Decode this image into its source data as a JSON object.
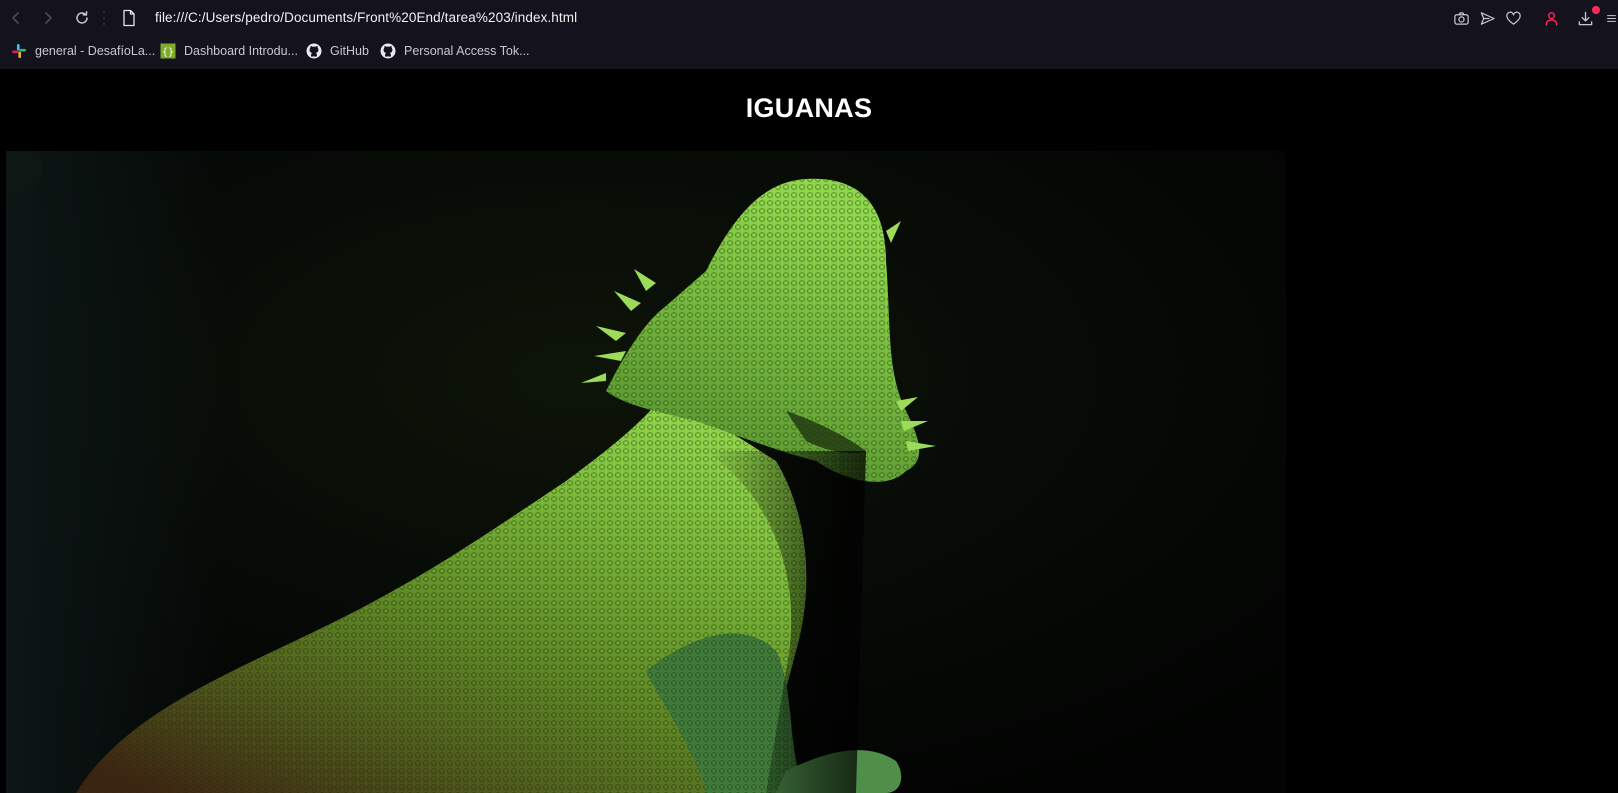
{
  "browser": {
    "url": "file:///C:/Users/pedro/Documents/Front%20End/tarea%203/index.html",
    "nav": {
      "back_icon": "chevron-left-icon",
      "forward_icon": "chevron-right-icon",
      "reload_icon": "reload-icon"
    },
    "toolbar_icons": [
      "camera-icon",
      "send-icon",
      "heart-icon",
      "profile-icon",
      "download-icon",
      "menu-icon"
    ],
    "accent_color": "#ff2d55",
    "bookmarks": [
      {
        "label": "general - DesafíoLa...",
        "icon": "slack-icon"
      },
      {
        "label": "Dashboard Introdu...",
        "icon": "code-braces-icon"
      },
      {
        "label": "GitHub",
        "icon": "github-icon"
      },
      {
        "label": "Personal Access Tok...",
        "icon": "github-icon"
      }
    ]
  },
  "page": {
    "title": "IGUANAS",
    "background": "#000000",
    "image": {
      "subject": "green bearded dragon lizard on dark background"
    }
  }
}
